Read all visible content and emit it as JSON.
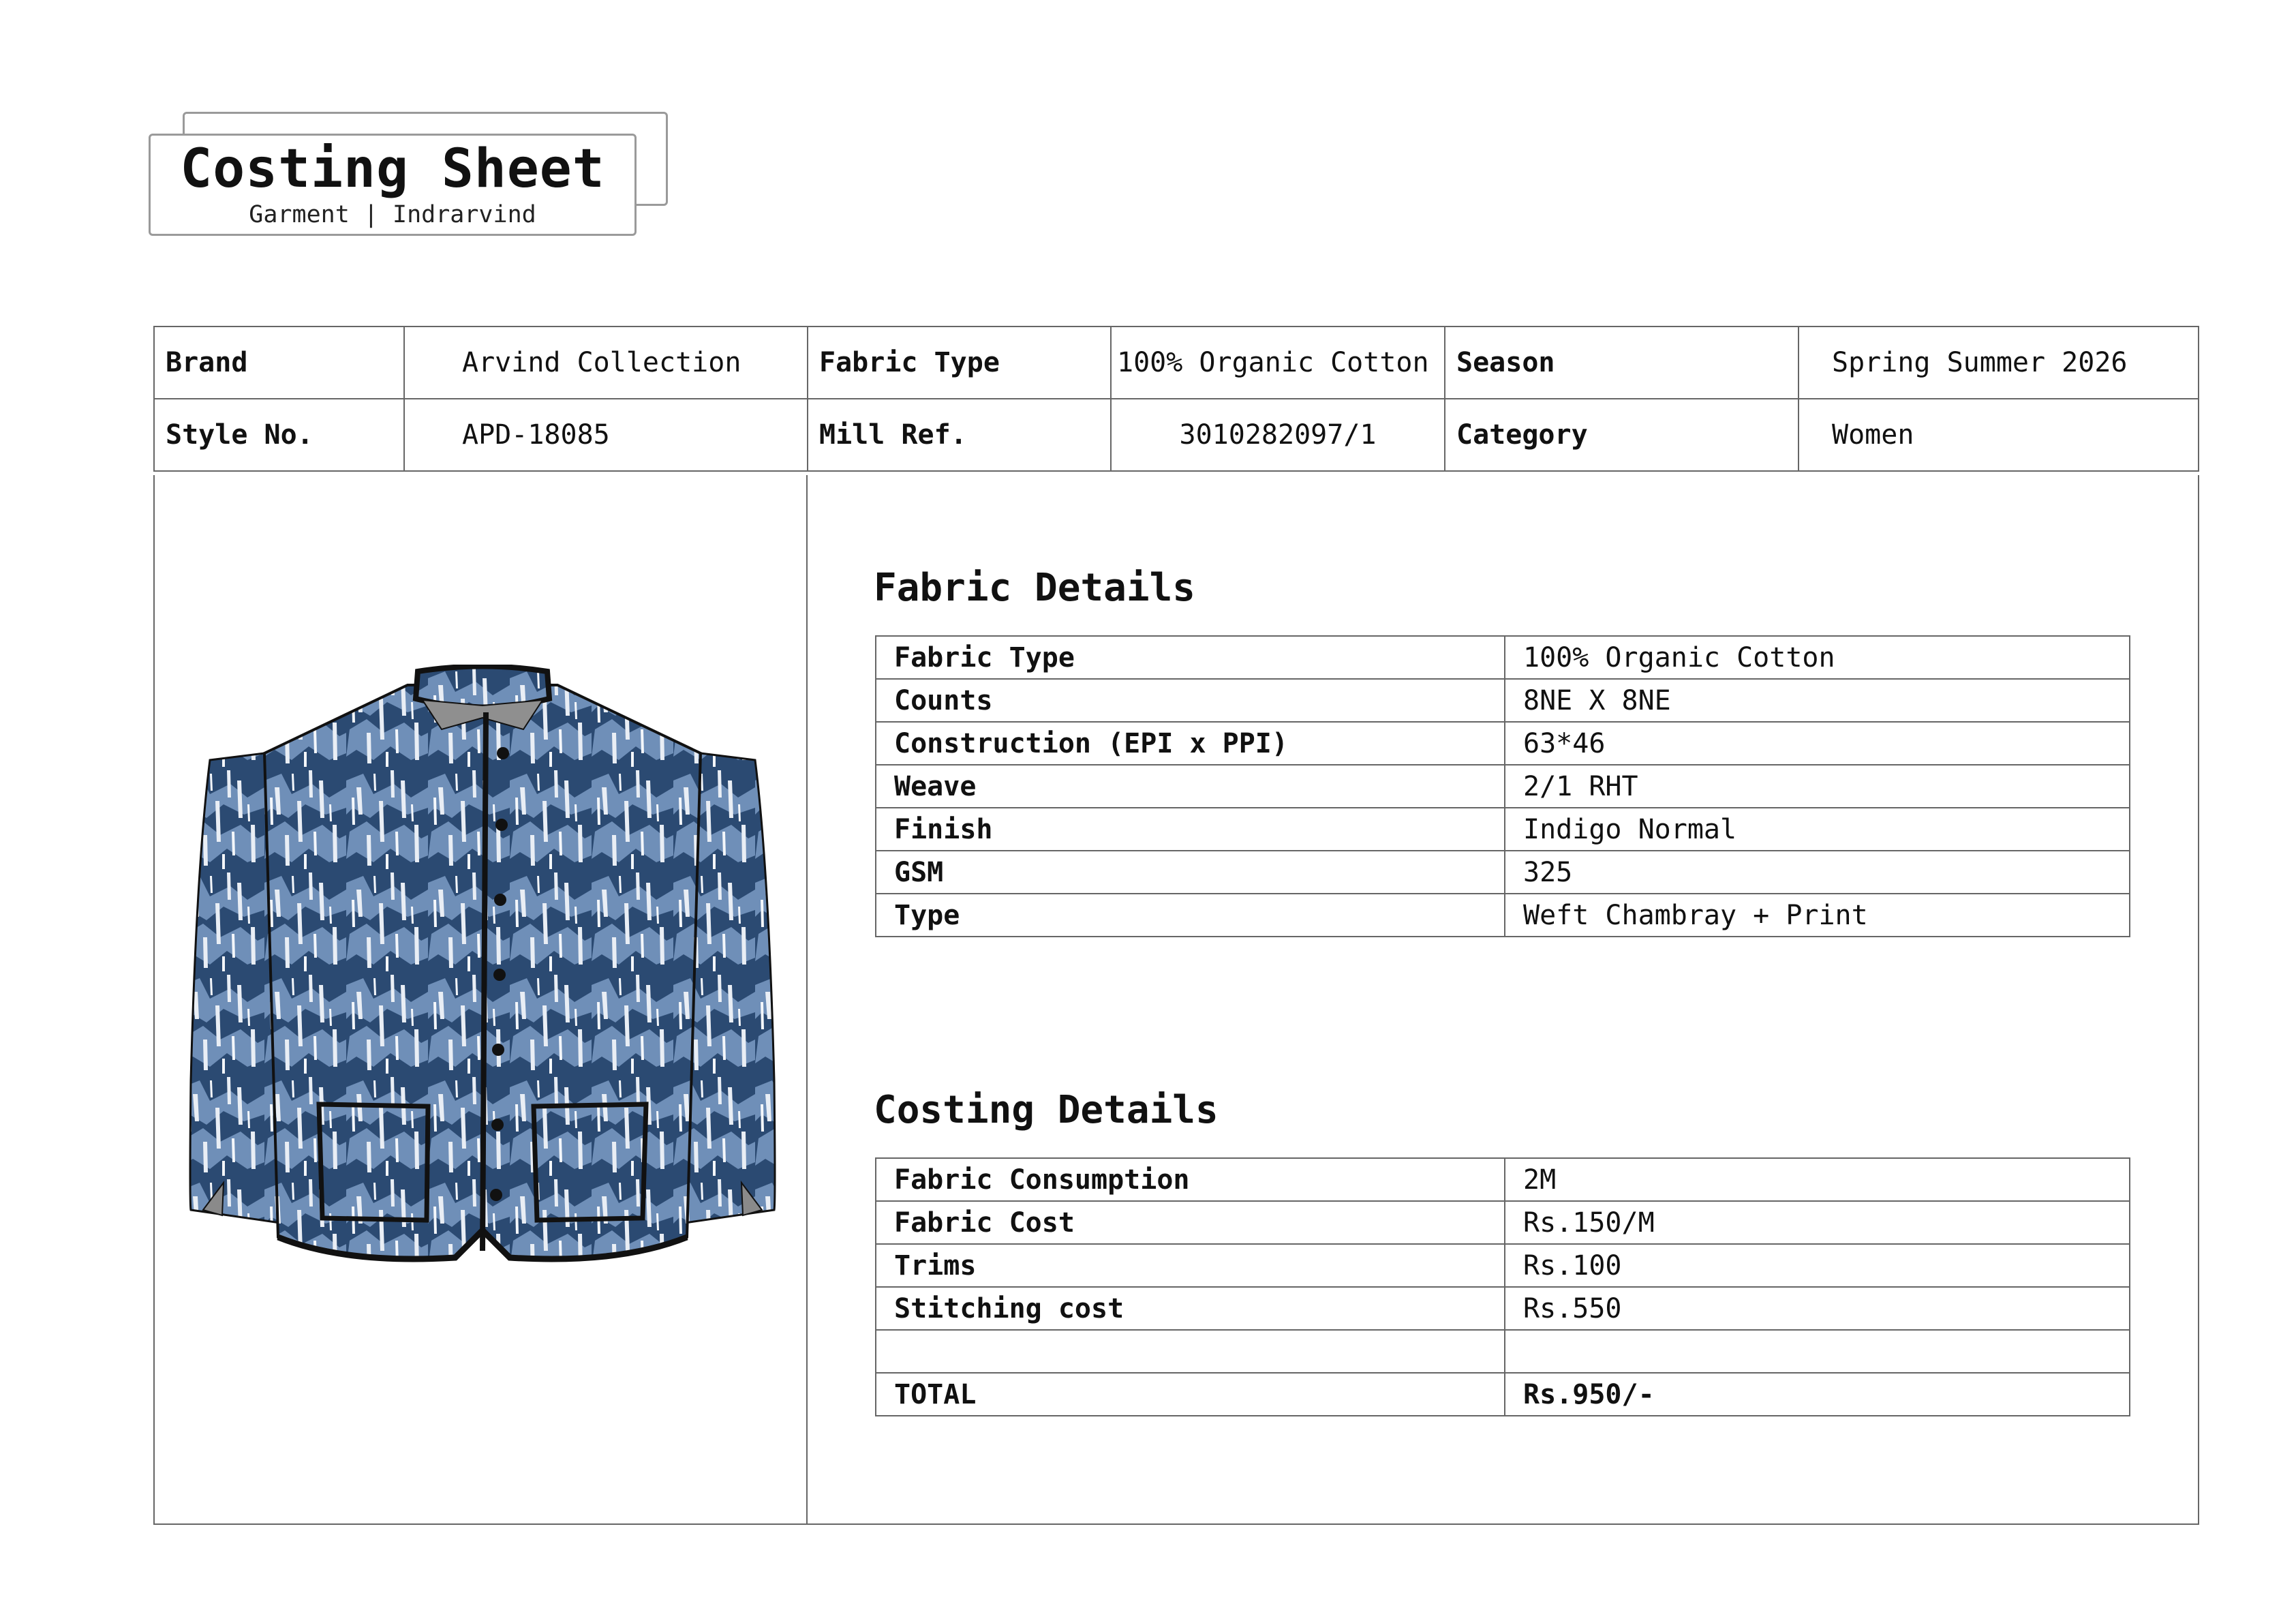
{
  "header": {
    "title": "Costing Sheet",
    "subtitle": "Garment | Indrarvind"
  },
  "info": {
    "row1": {
      "brand_label": "Brand",
      "brand_value": "Arvind Collection",
      "fabric_type_label": "Fabric Type",
      "fabric_type_value": "100% Organic Cotton",
      "season_label": "Season",
      "season_value": "Spring Summer 2026"
    },
    "row2": {
      "style_label": "Style No.",
      "style_value": "APD-18085",
      "mill_label": "Mill Ref.",
      "mill_value": "3010282097/1",
      "category_label": "Category",
      "category_value": "Women"
    }
  },
  "fabric_details": {
    "title": "Fabric Details",
    "rows": [
      {
        "label": "Fabric Type",
        "value": "100% Organic Cotton"
      },
      {
        "label": "Counts",
        "value": "8NE X 8NE"
      },
      {
        "label": "Construction (EPI x PPI)",
        "value": "63*46"
      },
      {
        "label": "Weave",
        "value": "2/1 RHT"
      },
      {
        "label": "Finish",
        "value": "Indigo Normal"
      },
      {
        "label": "GSM",
        "value": "325"
      },
      {
        "label": "Type",
        "value": "Weft Chambray + Print"
      }
    ]
  },
  "costing_details": {
    "title": "Costing Details",
    "rows": [
      {
        "label": "Fabric Consumption",
        "value": "2M"
      },
      {
        "label": "Fabric Cost",
        "value": "Rs.150/M"
      },
      {
        "label": "Trims",
        "value": "Rs.100"
      },
      {
        "label": "Stitching cost",
        "value": "Rs.550"
      },
      {
        "label": "",
        "value": ""
      },
      {
        "label": "TOTAL",
        "value": "Rs.950/-"
      }
    ]
  },
  "garment": {
    "icon": "printed-jacket-illustration",
    "colors": {
      "dark_indigo": "#2b4a72",
      "mid_blue": "#6f8fb8",
      "white": "#e9eef5",
      "trim": "#111111"
    }
  }
}
